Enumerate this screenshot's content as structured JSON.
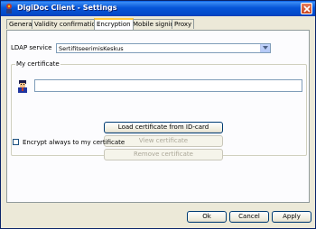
{
  "window": {
    "title": "DigiDoc Client - Settings"
  },
  "tabs": [
    {
      "label": "General"
    },
    {
      "label": "Validity confirmation"
    },
    {
      "label": "Encryption",
      "active": true
    },
    {
      "label": "Mobile signing"
    },
    {
      "label": "Proxy"
    }
  ],
  "encryption": {
    "ldap_label": "LDAP service",
    "ldap_value": "SertifitseerimisKeskus",
    "certificate_group": "My certificate",
    "certificate_value": "",
    "load_button": "Load certificate from ID-card",
    "view_button": "View certificate",
    "remove_button": "Remove certificate",
    "encrypt_checkbox": "Encrypt always to my certificate",
    "encrypt_checked": false
  },
  "footer": {
    "ok": "Ok",
    "cancel": "Cancel",
    "apply": "Apply"
  },
  "icons": {
    "app": "digidoc-app-icon",
    "close": "close-icon",
    "dropdown": "chevron-down-icon",
    "certificate": "id-card-person-icon"
  }
}
